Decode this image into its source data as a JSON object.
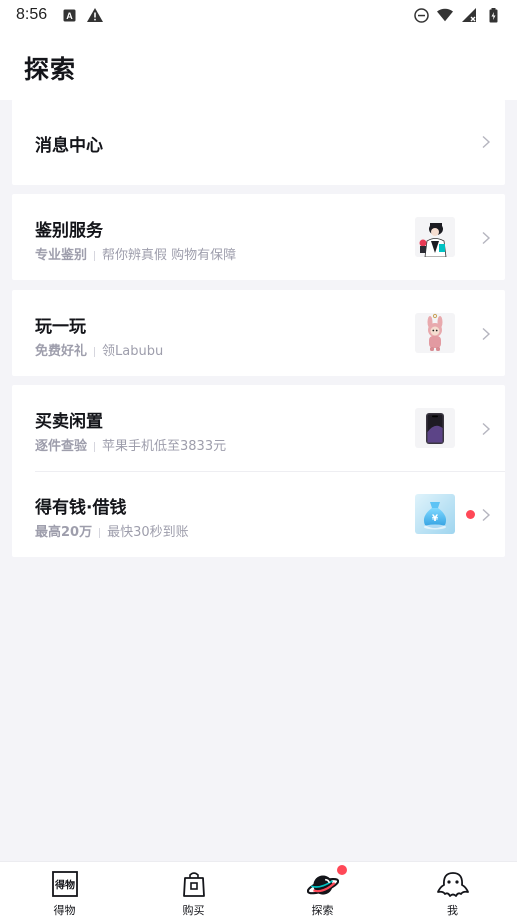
{
  "status_bar": {
    "time": "8:56",
    "left_icons": [
      "a-box-icon",
      "warning-icon"
    ],
    "right_icons": [
      "dnd-icon",
      "wifi-icon",
      "signal-icon",
      "battery-icon"
    ]
  },
  "header": {
    "title": "探索"
  },
  "sections": [
    {
      "rows": [
        {
          "title": "消息中心",
          "tag": "",
          "desc": "",
          "thumb": "",
          "dot": false
        }
      ]
    },
    {
      "rows": [
        {
          "title": "鉴别服务",
          "tag": "专业鉴别",
          "desc": "帮你辨真假 购物有保障",
          "thumb": "appraiser-figure",
          "dot": false
        }
      ]
    },
    {
      "rows": [
        {
          "title": "玩一玩",
          "tag": "免费好礼",
          "desc": "领Labubu",
          "thumb": "labubu-doll",
          "dot": false
        }
      ]
    },
    {
      "rows": [
        {
          "title": "买卖闲置",
          "tag": "逐件查验",
          "desc": "苹果手机低至3833元",
          "thumb": "iphone",
          "dot": false
        },
        {
          "title": "得有钱·借钱",
          "tag": "最高20万",
          "desc": "最快30秒到账",
          "thumb": "money-bag",
          "dot": true
        }
      ]
    }
  ],
  "tabbar": {
    "tabs": [
      {
        "label": "得物",
        "icon": "dewu-logo-icon",
        "badge": false
      },
      {
        "label": "购买",
        "icon": "shopping-bag-icon",
        "badge": false
      },
      {
        "label": "探索",
        "icon": "planet-icon",
        "badge": true
      },
      {
        "label": "我",
        "icon": "profile-mascot-icon",
        "badge": false
      }
    ]
  },
  "colors": {
    "background": "#f4f4f8",
    "card": "#ffffff",
    "title": "#14151a",
    "subtext": "#9e9eac",
    "badge": "#ff4857",
    "accent": "#01c2c3"
  }
}
